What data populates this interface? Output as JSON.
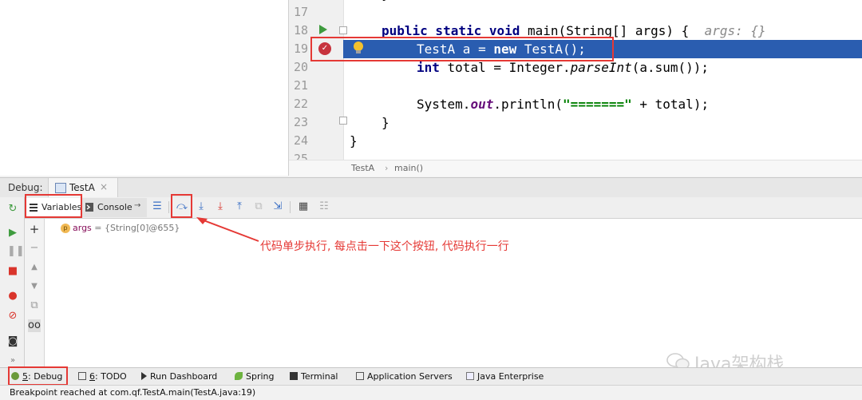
{
  "editor": {
    "line_numbers": [
      "17",
      "18",
      "19",
      "20",
      "21",
      "22",
      "23",
      "24",
      "25"
    ],
    "hint": "args: {}",
    "breadcrumb": [
      "TestA",
      "main()"
    ]
  },
  "debug": {
    "label": "Debug:",
    "session_tab": "TestA",
    "tabs": {
      "variables": "Variables",
      "console": "Console"
    },
    "variable": {
      "badge": "p",
      "name": "args",
      "value": "= {String[0]@655}"
    }
  },
  "annotation": "代码单步执行, 每点击一下这个按钮, 代码执行一行",
  "watermark": "Java架构栈",
  "bottom_tools": [
    {
      "key": "5",
      "label": ": Debug"
    },
    {
      "key": "6",
      "label": ": TODO"
    },
    {
      "key": "",
      "label": "Run Dashboard"
    },
    {
      "key": "",
      "label": "Spring"
    },
    {
      "key": "",
      "label": "Terminal"
    },
    {
      "key": "",
      "label": "Application Servers"
    },
    {
      "key": "",
      "label": "Java Enterprise"
    }
  ],
  "status": "Breakpoint reached at com.qf.TestA.main(TestA.java:19)",
  "colors": {
    "highlight": "#2a5db0",
    "annotation": "#e53935",
    "keyword": "#000080",
    "string": "#008000",
    "breakpoint": "#c7333d"
  },
  "icons": [
    "run-arrow-icon",
    "breakpoint-icon",
    "lightbulb-icon",
    "rerun-icon",
    "resume-icon",
    "pause-icon",
    "stop-icon",
    "view-breakpoints-icon",
    "mute-breakpoints-icon",
    "camera-icon",
    "step-over-icon",
    "step-into-icon",
    "force-step-into-icon",
    "step-out-icon",
    "evaluate-icon"
  ]
}
